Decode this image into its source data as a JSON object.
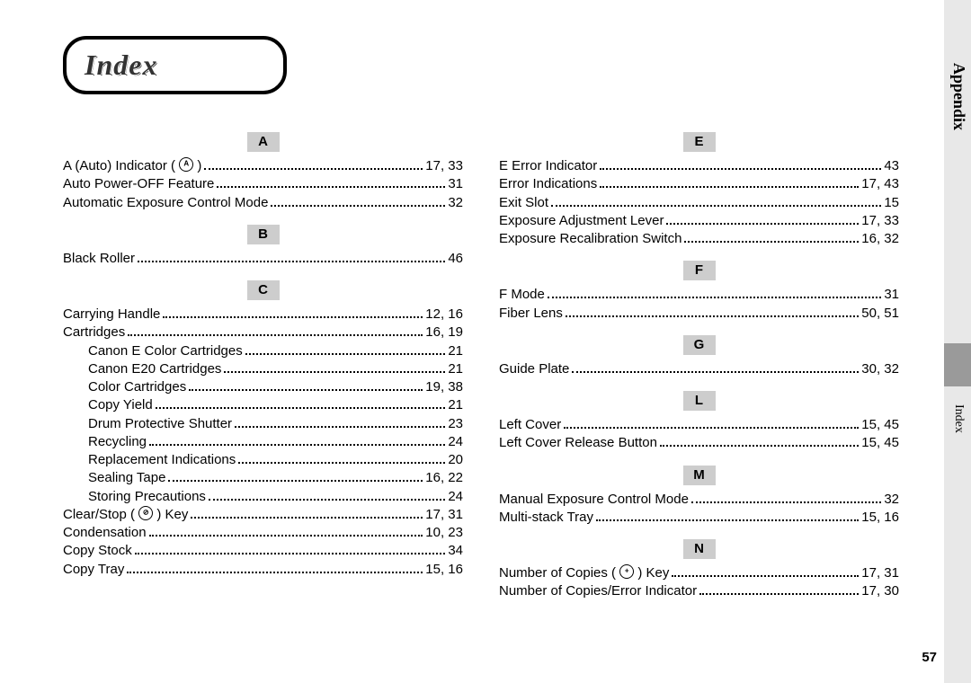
{
  "title": "Index",
  "side": {
    "section": "Appendix",
    "sub": "Index"
  },
  "page_number": "57",
  "left": [
    {
      "type": "letter",
      "text": "A"
    },
    {
      "type": "row",
      "label": "A (Auto) Indicator ( ",
      "icon": "A",
      "label2": " )",
      "pages": "17, 33"
    },
    {
      "type": "row",
      "label": "Auto Power-OFF Feature",
      "pages": "31"
    },
    {
      "type": "row",
      "label": "Automatic Exposure Control Mode",
      "pages": "32"
    },
    {
      "type": "letter",
      "text": "B"
    },
    {
      "type": "row",
      "label": "Black Roller",
      "pages": "46"
    },
    {
      "type": "letter",
      "text": "C"
    },
    {
      "type": "row",
      "label": "Carrying Handle",
      "pages": "12, 16"
    },
    {
      "type": "row",
      "label": "Cartridges",
      "pages": "16, 19"
    },
    {
      "type": "row",
      "indent": true,
      "label": "Canon E Color Cartridges",
      "pages": "21"
    },
    {
      "type": "row",
      "indent": true,
      "label": "Canon E20 Cartridges",
      "pages": "21"
    },
    {
      "type": "row",
      "indent": true,
      "label": "Color Cartridges",
      "pages": "19, 38"
    },
    {
      "type": "row",
      "indent": true,
      "label": "Copy Yield",
      "pages": "21"
    },
    {
      "type": "row",
      "indent": true,
      "label": "Drum Protective Shutter",
      "pages": "23"
    },
    {
      "type": "row",
      "indent": true,
      "label": "Recycling",
      "pages": "24"
    },
    {
      "type": "row",
      "indent": true,
      "label": "Replacement Indications",
      "pages": "20"
    },
    {
      "type": "row",
      "indent": true,
      "label": "Sealing Tape",
      "pages": "16, 22"
    },
    {
      "type": "row",
      "indent": true,
      "label": "Storing Precautions",
      "pages": "24"
    },
    {
      "type": "row",
      "label": "Clear/Stop ( ",
      "icon": "⊘",
      "label2": " ) Key",
      "pages": "17, 31"
    },
    {
      "type": "row",
      "label": "Condensation",
      "pages": "10, 23"
    },
    {
      "type": "row",
      "label": "Copy Stock",
      "pages": "34"
    },
    {
      "type": "row",
      "label": "Copy Tray",
      "pages": "15, 16"
    }
  ],
  "right": [
    {
      "type": "letter",
      "text": "E"
    },
    {
      "type": "row",
      "label": "E Error Indicator",
      "pages": "43"
    },
    {
      "type": "row",
      "label": "Error Indications",
      "pages": "17, 43"
    },
    {
      "type": "row",
      "label": "Exit Slot",
      "pages": "15"
    },
    {
      "type": "row",
      "label": "Exposure Adjustment Lever",
      "pages": "17, 33"
    },
    {
      "type": "row",
      "label": "Exposure Recalibration Switch",
      "pages": "16, 32"
    },
    {
      "type": "letter",
      "text": "F"
    },
    {
      "type": "row",
      "label": "F Mode",
      "pages": "31"
    },
    {
      "type": "row",
      "label": "Fiber Lens",
      "pages": "50, 51"
    },
    {
      "type": "letter",
      "text": "G"
    },
    {
      "type": "row",
      "label": "Guide Plate",
      "pages": "30, 32"
    },
    {
      "type": "letter",
      "text": "L"
    },
    {
      "type": "row",
      "label": "Left Cover",
      "pages": "15, 45"
    },
    {
      "type": "row",
      "label": "Left Cover Release Button",
      "pages": "15, 45"
    },
    {
      "type": "letter",
      "text": "M"
    },
    {
      "type": "row",
      "label": "Manual Exposure Control Mode",
      "pages": "32"
    },
    {
      "type": "row",
      "label": "Multi-stack Tray",
      "pages": "15, 16"
    },
    {
      "type": "letter",
      "text": "N"
    },
    {
      "type": "row",
      "label": "Number of Copies ( ",
      "icon": "+",
      "label2": " ) Key",
      "pages": "17, 31"
    },
    {
      "type": "row",
      "label": "Number of Copies/Error Indicator",
      "pages": "17, 30"
    }
  ]
}
